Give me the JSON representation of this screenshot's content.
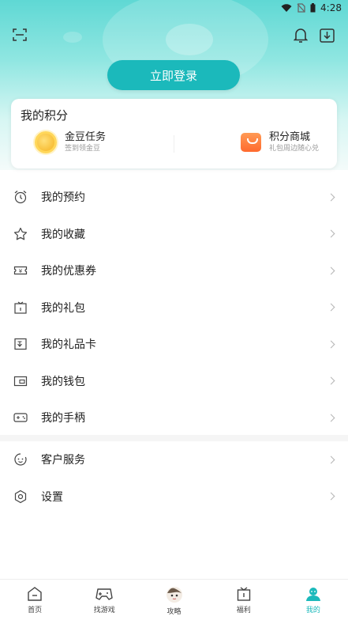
{
  "status_bar": {
    "time": "4:28"
  },
  "header": {
    "login_button": "立即登录"
  },
  "points_card": {
    "title": "我的积分",
    "items": [
      {
        "name": "金豆任务",
        "sub": "签到领金豆",
        "icon": "coin-icon"
      },
      {
        "name": "积分商城",
        "sub": "礼包周边随心兑",
        "icon": "shop-bag-icon"
      }
    ]
  },
  "menu": {
    "group1": [
      {
        "label": "我的预约",
        "icon": "alarm-clock-icon"
      },
      {
        "label": "我的收藏",
        "icon": "star-icon"
      },
      {
        "label": "我的优惠券",
        "icon": "coupon-icon"
      },
      {
        "label": "我的礼包",
        "icon": "gift-icon"
      },
      {
        "label": "我的礼品卡",
        "icon": "gift-card-icon"
      },
      {
        "label": "我的钱包",
        "icon": "wallet-icon"
      },
      {
        "label": "我的手柄",
        "icon": "gamepad-icon"
      }
    ],
    "group2": [
      {
        "label": "客户服务",
        "icon": "customer-service-icon"
      },
      {
        "label": "设置",
        "icon": "settings-icon"
      }
    ]
  },
  "tabbar": {
    "tabs": [
      {
        "label": "首页",
        "icon": "home-icon"
      },
      {
        "label": "找游戏",
        "icon": "game-controller-icon"
      },
      {
        "label": "攻略",
        "icon": "avatar-icon"
      },
      {
        "label": "福利",
        "icon": "gift-box-icon"
      },
      {
        "label": "我的",
        "icon": "user-icon",
        "active": true
      }
    ]
  },
  "colors": {
    "accent": "#1bb9bb",
    "hero_top": "#5fd8d4",
    "coin": "#f5b21f",
    "shop": "#ff6a2e"
  }
}
